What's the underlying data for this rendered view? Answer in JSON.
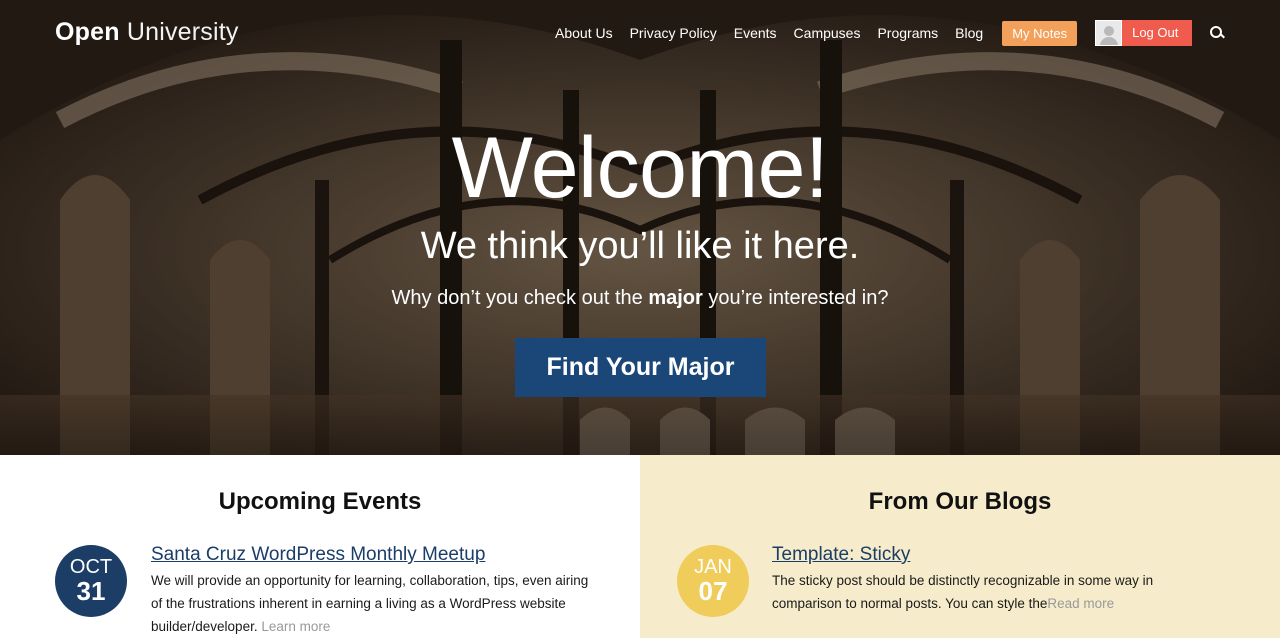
{
  "header": {
    "logo_bold": "Open",
    "logo_light": "University",
    "nav": [
      "About Us",
      "Privacy Policy",
      "Events",
      "Campuses",
      "Programs",
      "Blog"
    ],
    "my_notes": "My Notes",
    "logout": "Log Out"
  },
  "hero": {
    "title": "Welcome!",
    "subtitle": "We think you’ll like it here.",
    "question_before": "Why don’t you check out the ",
    "question_bold": "major",
    "question_after": " you’re interested in?",
    "cta": "Find Your Major"
  },
  "events": {
    "heading": "Upcoming Events",
    "item": {
      "month": "OCT",
      "day": "31",
      "title": "Santa Cruz WordPress Monthly Meetup",
      "desc": "We will provide an opportunity for learning, collaboration, tips, even airing of the frustrations inherent in earning a living as a WordPress website builder/developer.",
      "more": "Learn more"
    }
  },
  "blogs": {
    "heading": "From Our Blogs",
    "item": {
      "month": "JAN",
      "day": "07",
      "title": "Template: Sticky",
      "desc": "The sticky post should be distinctly recognizable in some way in comparison to normal posts. You can style the",
      "more": "Read more"
    }
  },
  "colors": {
    "navy": "#1b4778",
    "orange": "#f3a05a",
    "red": "#ef5b4d",
    "cream": "#f6eccb",
    "gold": "#f0cc5a"
  }
}
